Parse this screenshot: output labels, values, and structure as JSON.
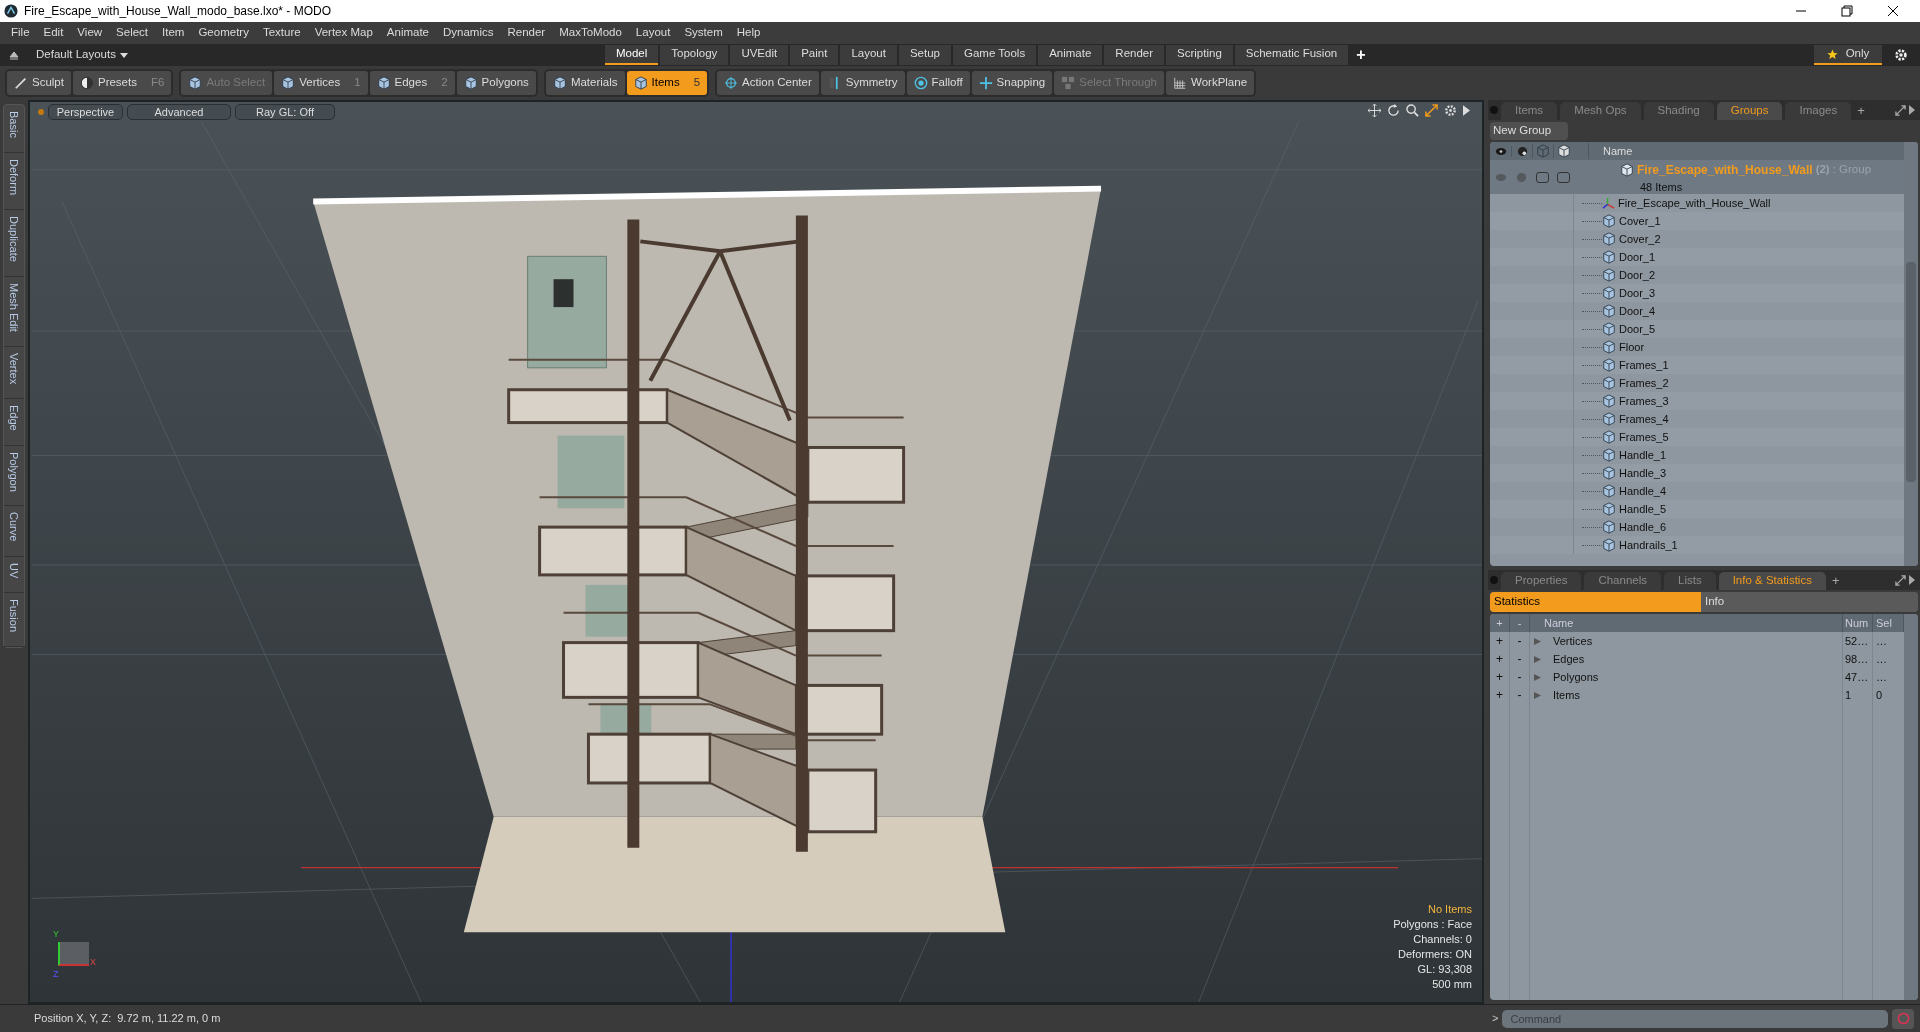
{
  "window": {
    "title": "Fire_Escape_with_House_Wall_modo_base.lxo* - MODO"
  },
  "menu": [
    "File",
    "Edit",
    "View",
    "Select",
    "Item",
    "Geometry",
    "Texture",
    "Vertex Map",
    "Animate",
    "Dynamics",
    "Render",
    "MaxToModo",
    "Layout",
    "System",
    "Help"
  ],
  "layout_selector": "Default Layouts",
  "layout_tabs": [
    {
      "label": "Model",
      "selected": true
    },
    {
      "label": "Topology",
      "selected": false
    },
    {
      "label": "UVEdit",
      "selected": false
    },
    {
      "label": "Paint",
      "selected": false
    },
    {
      "label": "Layout",
      "selected": false
    },
    {
      "label": "Setup",
      "selected": false
    },
    {
      "label": "Game Tools",
      "selected": false
    },
    {
      "label": "Animate",
      "selected": false
    },
    {
      "label": "Render",
      "selected": false
    },
    {
      "label": "Scripting",
      "selected": false
    },
    {
      "label": "Schematic Fusion",
      "selected": false
    }
  ],
  "add_tab": "+",
  "only_button": "Only",
  "toolbar_groups": [
    {
      "items": [
        {
          "label": "Sculpt",
          "kind": "sculpt",
          "selected": false,
          "disabled": false
        },
        {
          "label": "Presets",
          "shortcut": "F6",
          "kind": "presets",
          "selected": false,
          "disabled": false
        }
      ]
    },
    {
      "items": [
        {
          "label": "Auto Select",
          "kind": "cube",
          "selected": false,
          "disabled": true
        },
        {
          "label": "Vertices",
          "shortcut": "1",
          "kind": "cube",
          "selected": false,
          "disabled": false
        },
        {
          "label": "Edges",
          "shortcut": "2",
          "kind": "cube",
          "selected": false,
          "disabled": false
        },
        {
          "label": "Polygons",
          "kind": "cube",
          "selected": false,
          "disabled": false
        }
      ]
    },
    {
      "items": [
        {
          "label": "Materials",
          "kind": "cube",
          "selected": false,
          "disabled": false
        },
        {
          "label": "Items",
          "shortcut": "5",
          "kind": "cube",
          "selected": true,
          "disabled": false
        }
      ]
    },
    {
      "items": [
        {
          "label": "Action Center",
          "kind": "target",
          "selected": false,
          "disabled": false
        },
        {
          "label": "Symmetry",
          "kind": "symmetry",
          "selected": false,
          "disabled": false
        },
        {
          "label": "Falloff",
          "kind": "falloff",
          "selected": false,
          "disabled": false
        },
        {
          "label": "Snapping",
          "kind": "snapping",
          "selected": false,
          "disabled": false
        },
        {
          "label": "Select Through",
          "kind": "select-through",
          "selected": false,
          "disabled": true
        },
        {
          "label": "WorkPlane",
          "kind": "workplane",
          "selected": false,
          "disabled": false
        }
      ]
    }
  ],
  "left_tabs": [
    "Basic",
    "Deform",
    "Duplicate",
    "Mesh Edit",
    "Vertex",
    "Edge",
    "Polygon",
    "Curve",
    "UV",
    "Fusion"
  ],
  "viewport": {
    "buttons": [
      "Perspective",
      "Advanced",
      "Ray GL: Off"
    ],
    "info": [
      {
        "text": "No Items",
        "highlight": true
      },
      {
        "text": "Polygons : Face",
        "highlight": false
      },
      {
        "text": "Channels: 0",
        "highlight": false
      },
      {
        "text": "Deformers: ON",
        "highlight": false
      },
      {
        "text": "GL: 93,308",
        "highlight": false
      },
      {
        "text": "500 mm",
        "highlight": false
      }
    ],
    "axis_labels": [
      "Y",
      "X",
      "Z"
    ]
  },
  "groups_panel": {
    "tabs": [
      {
        "label": "Items",
        "selected": false
      },
      {
        "label": "Mesh Ops",
        "selected": false
      },
      {
        "label": "Shading",
        "selected": false
      },
      {
        "label": "Groups",
        "selected": true
      },
      {
        "label": "Images",
        "selected": false
      }
    ],
    "add_tab": "+",
    "new_group": "New Group",
    "column_name": "Name",
    "group": {
      "name": "Fire_Escape_with_House_Wall",
      "count": "(2)",
      "type": ": Group",
      "items_label": "48 Items"
    },
    "children": [
      {
        "name": "Fire_Escape_with_House_Wall",
        "kind": "locator"
      },
      {
        "name": "Cover_1",
        "kind": "mesh"
      },
      {
        "name": "Cover_2",
        "kind": "mesh"
      },
      {
        "name": "Door_1",
        "kind": "mesh"
      },
      {
        "name": "Door_2",
        "kind": "mesh"
      },
      {
        "name": "Door_3",
        "kind": "mesh"
      },
      {
        "name": "Door_4",
        "kind": "mesh"
      },
      {
        "name": "Door_5",
        "kind": "mesh"
      },
      {
        "name": "Floor",
        "kind": "mesh"
      },
      {
        "name": "Frames_1",
        "kind": "mesh"
      },
      {
        "name": "Frames_2",
        "kind": "mesh"
      },
      {
        "name": "Frames_3",
        "kind": "mesh"
      },
      {
        "name": "Frames_4",
        "kind": "mesh"
      },
      {
        "name": "Frames_5",
        "kind": "mesh"
      },
      {
        "name": "Handle_1",
        "kind": "mesh"
      },
      {
        "name": "Handle_3",
        "kind": "mesh"
      },
      {
        "name": "Handle_4",
        "kind": "mesh"
      },
      {
        "name": "Handle_5",
        "kind": "mesh"
      },
      {
        "name": "Handle_6",
        "kind": "mesh"
      },
      {
        "name": "Handrails_1",
        "kind": "mesh"
      }
    ]
  },
  "stats_panel": {
    "tabs": [
      {
        "label": "Properties",
        "selected": false
      },
      {
        "label": "Channels",
        "selected": false
      },
      {
        "label": "Lists",
        "selected": false
      },
      {
        "label": "Info & Statistics",
        "selected": true
      }
    ],
    "add_tab": "+",
    "subtabs": [
      {
        "label": "Statistics",
        "selected": true
      },
      {
        "label": "Info",
        "selected": false
      }
    ],
    "columns": [
      "+",
      "-",
      "Name",
      "Num",
      "Sel"
    ],
    "rows": [
      {
        "add": "+",
        "remove": "-",
        "name": "Vertices",
        "num": "52…",
        "sel": "…"
      },
      {
        "add": "+",
        "remove": "-",
        "name": "Edges",
        "num": "98…",
        "sel": "…"
      },
      {
        "add": "+",
        "remove": "-",
        "name": "Polygons",
        "num": "47…",
        "sel": "…"
      },
      {
        "add": "+",
        "remove": "-",
        "name": "Items",
        "num": "1",
        "sel": "0"
      }
    ]
  },
  "command": {
    "prompt": ">",
    "placeholder": "Command"
  },
  "status_bar": {
    "label": "Position X, Y, Z:",
    "value": "9.72 m, 11.22 m, 0 m"
  }
}
